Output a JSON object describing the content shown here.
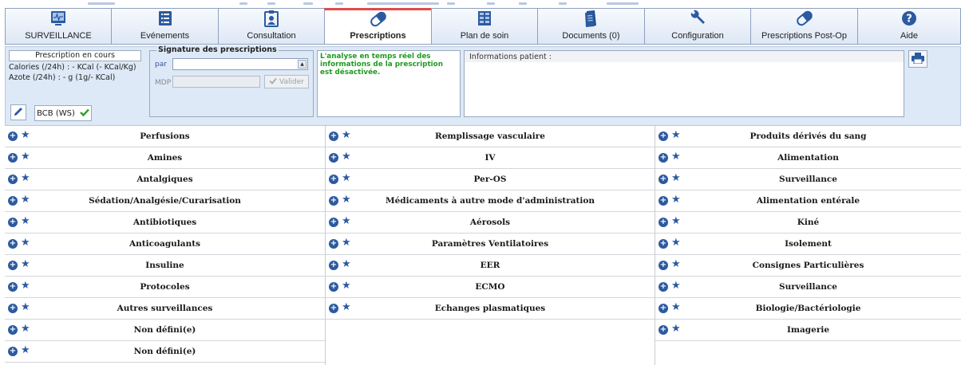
{
  "tabs": [
    {
      "label": "SURVEILLANCE",
      "icon": "monitor-icon",
      "active": false
    },
    {
      "label": "Evénements",
      "icon": "list-icon",
      "active": false
    },
    {
      "label": "Consultation",
      "icon": "id-badge-icon",
      "active": false
    },
    {
      "label": "Prescriptions",
      "icon": "pill-icon",
      "active": true
    },
    {
      "label": "Plan de soin",
      "icon": "grid-table-icon",
      "active": false
    },
    {
      "label": "Documents (0)",
      "icon": "documents-icon",
      "active": false
    },
    {
      "label": "Configuration",
      "icon": "wrench-icon",
      "active": false
    },
    {
      "label": "Prescriptions Post-Op",
      "icon": "pill-icon",
      "active": false
    },
    {
      "label": "Aide",
      "icon": "help-icon",
      "active": false
    }
  ],
  "current_prescription": {
    "title": "Prescription en cours",
    "calories": "Calories (/24h) : - KCal (- KCal/Kg)",
    "azote": "Azote (/24h) : - g (1g/- KCal)",
    "bcb_label": "BCB (WS)"
  },
  "signature": {
    "title": "Signature des prescriptions",
    "par_label": "par",
    "par_value": "",
    "mdp_label": "MDP",
    "validate_label": "Valider"
  },
  "analysis_notice": "L'analyse en temps réel des informations de la prescription est désactivée.",
  "patient_info_label": "Informations patient :",
  "categories": {
    "col1": [
      "Perfusions",
      "Amines",
      "Antalgiques",
      "Sédation/Analgésie/Curarisation",
      "Antibiotiques",
      "Anticoagulants",
      "Insuline",
      "Protocoles",
      "Autres surveillances",
      "Non défini(e)",
      "Non défini(e)"
    ],
    "col2": [
      "Remplissage vasculaire",
      "IV",
      "Per-OS",
      "Médicaments à autre mode d'administration",
      "Aérosols",
      "Paramètres Ventilatoires",
      "EER",
      "ECMO",
      "Echanges plasmatiques"
    ],
    "col3": [
      "Produits dérivés du sang",
      "Alimentation",
      "Surveillance",
      "Alimentation entérale",
      "Kiné",
      "Isolement",
      "Consignes Particulières",
      "Surveillance",
      "Biologie/Bactériologie",
      "Imagerie"
    ]
  },
  "colors": {
    "accent_blue": "#2c5aa0",
    "active_tab_top": "#e04a4a",
    "notice_green": "#1f9a1f",
    "header_bg": "#dde9f7"
  }
}
